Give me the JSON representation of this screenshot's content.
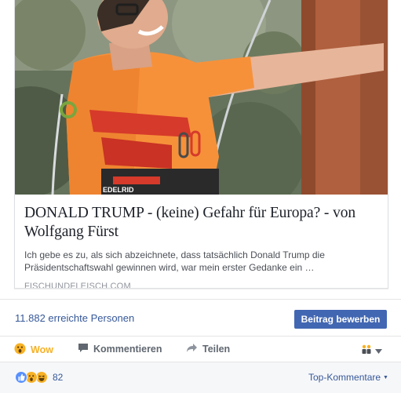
{
  "link_card": {
    "title": "DONALD TRUMP - (keine) Gefahr für Europa? - von Wolfgang Fürst",
    "description": "Ich gebe es zu, als sich abzeichnete, dass tatsächlich Donald Trump die Präsidentschaftswahl gewinnen wird, war mein erster Gedanke ein …",
    "domain": "FISCHUNDFLEISCH.COM",
    "image_logo_text": "EDELRID"
  },
  "reach": {
    "text": "11.882 erreichte Personen",
    "boost_label": "Beitrag bewerben"
  },
  "actions": {
    "wow_label": "Wow",
    "comment_label": "Kommentieren",
    "share_label": "Teilen"
  },
  "summary": {
    "reaction_count": "82",
    "top_comments_label": "Top-Kommentare"
  },
  "colors": {
    "link_blue": "#365899",
    "button_blue": "#4267b2",
    "wow_yellow": "#f7b125",
    "like_blue": "#5890ff",
    "shirt_orange": "#f6913a"
  },
  "icons": {
    "wow": "wow-emoji-icon",
    "comment": "speech-bubble-icon",
    "share": "share-arrow-icon",
    "audience": "friends-icon"
  }
}
